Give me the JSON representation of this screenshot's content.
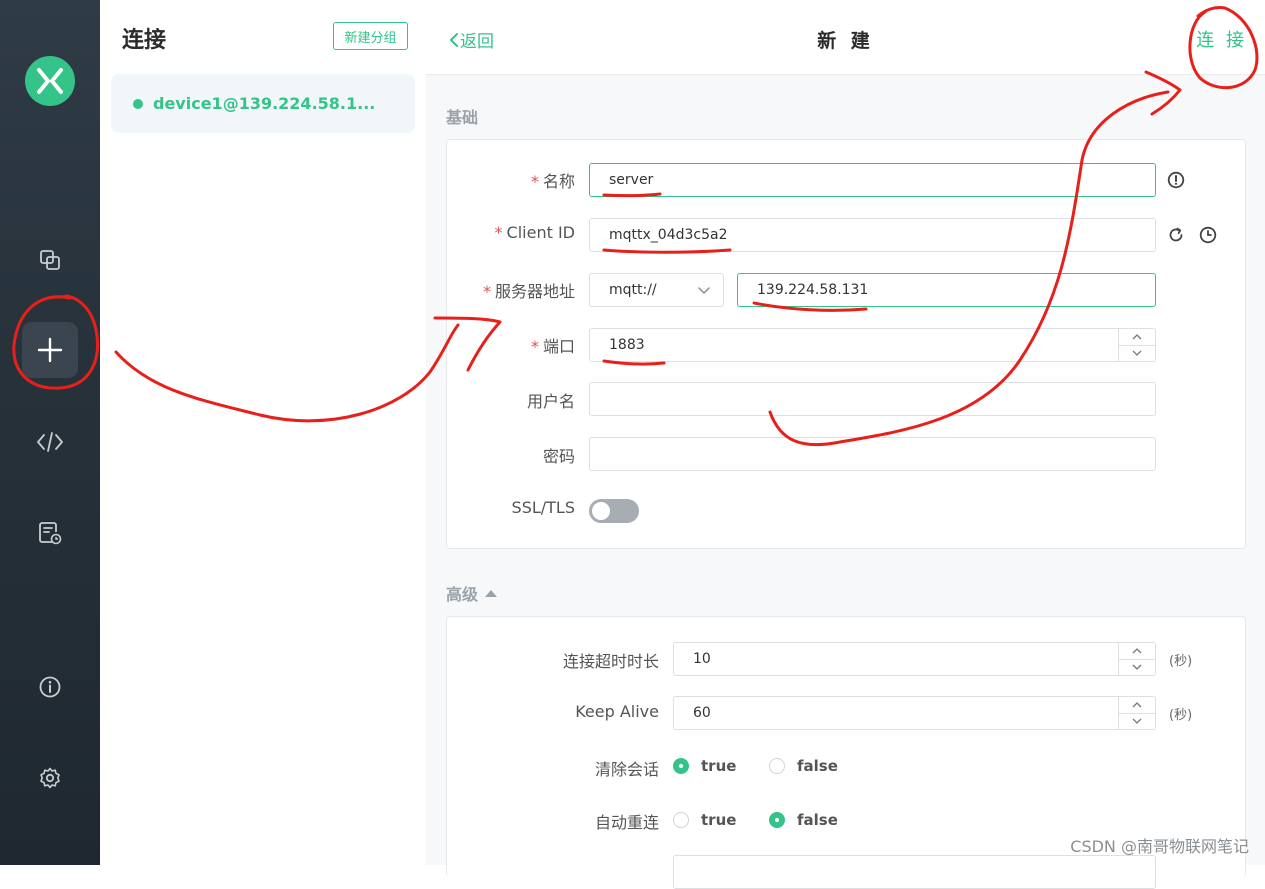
{
  "list": {
    "title": "连接",
    "new_group_label": "新建分组",
    "connections": [
      {
        "name": "device1@139.224.58.1...",
        "status_color": "#34c388"
      }
    ]
  },
  "header": {
    "back_label": "返回",
    "title": "新 建",
    "connect_label": "连 接"
  },
  "basic": {
    "section_label": "基础",
    "name": {
      "label": "名称",
      "value": "server"
    },
    "client_id": {
      "label": "Client ID",
      "value": "mqttx_04d3c5a2"
    },
    "host": {
      "label": "服务器地址",
      "protocol": "mqtt://",
      "value": "139.224.58.131"
    },
    "port": {
      "label": "端口",
      "value": "1883"
    },
    "username": {
      "label": "用户名",
      "value": ""
    },
    "password": {
      "label": "密码",
      "value": ""
    },
    "ssl": {
      "label": "SSL/TLS",
      "enabled": false
    }
  },
  "advanced": {
    "section_label": "高级",
    "connect_timeout": {
      "label": "连接超时时长",
      "value": "10",
      "unit": "(秒)"
    },
    "keep_alive": {
      "label": "Keep Alive",
      "value": "60",
      "unit": "(秒)"
    },
    "clean_session": {
      "label": "清除会话",
      "options": [
        "true",
        "false"
      ],
      "selected": "true"
    },
    "auto_reconnect": {
      "label": "自动重连",
      "options": [
        "true",
        "false"
      ],
      "selected": "false"
    }
  },
  "watermark": "CSDN @南哥物联网笔记",
  "colors": {
    "accent": "#34c388",
    "rail": "#2b353e",
    "annotation": "#e8201c"
  },
  "icons": {
    "rail": [
      "mqttx-logo-icon",
      "connections-icon",
      "plus-icon",
      "code-icon",
      "log-icon",
      "info-icon",
      "gear-icon"
    ],
    "fields": [
      "alert-circle-icon",
      "refresh-icon",
      "clock-icon",
      "chevron-left-icon",
      "chevron-down-icon",
      "caret-up-icon"
    ]
  }
}
